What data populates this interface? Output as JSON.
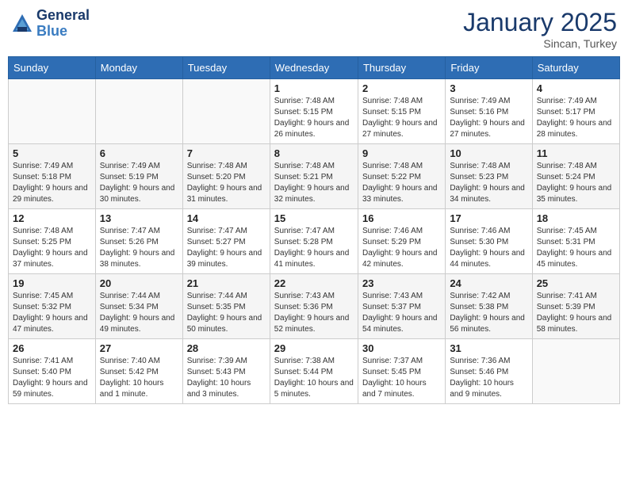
{
  "header": {
    "logo_line1": "General",
    "logo_line2": "Blue",
    "month": "January 2025",
    "location": "Sincan, Turkey"
  },
  "weekdays": [
    "Sunday",
    "Monday",
    "Tuesday",
    "Wednesday",
    "Thursday",
    "Friday",
    "Saturday"
  ],
  "weeks": [
    [
      {
        "day": "",
        "info": ""
      },
      {
        "day": "",
        "info": ""
      },
      {
        "day": "",
        "info": ""
      },
      {
        "day": "1",
        "info": "Sunrise: 7:48 AM\nSunset: 5:15 PM\nDaylight: 9 hours and 26 minutes."
      },
      {
        "day": "2",
        "info": "Sunrise: 7:48 AM\nSunset: 5:15 PM\nDaylight: 9 hours and 27 minutes."
      },
      {
        "day": "3",
        "info": "Sunrise: 7:49 AM\nSunset: 5:16 PM\nDaylight: 9 hours and 27 minutes."
      },
      {
        "day": "4",
        "info": "Sunrise: 7:49 AM\nSunset: 5:17 PM\nDaylight: 9 hours and 28 minutes."
      }
    ],
    [
      {
        "day": "5",
        "info": "Sunrise: 7:49 AM\nSunset: 5:18 PM\nDaylight: 9 hours and 29 minutes."
      },
      {
        "day": "6",
        "info": "Sunrise: 7:49 AM\nSunset: 5:19 PM\nDaylight: 9 hours and 30 minutes."
      },
      {
        "day": "7",
        "info": "Sunrise: 7:48 AM\nSunset: 5:20 PM\nDaylight: 9 hours and 31 minutes."
      },
      {
        "day": "8",
        "info": "Sunrise: 7:48 AM\nSunset: 5:21 PM\nDaylight: 9 hours and 32 minutes."
      },
      {
        "day": "9",
        "info": "Sunrise: 7:48 AM\nSunset: 5:22 PM\nDaylight: 9 hours and 33 minutes."
      },
      {
        "day": "10",
        "info": "Sunrise: 7:48 AM\nSunset: 5:23 PM\nDaylight: 9 hours and 34 minutes."
      },
      {
        "day": "11",
        "info": "Sunrise: 7:48 AM\nSunset: 5:24 PM\nDaylight: 9 hours and 35 minutes."
      }
    ],
    [
      {
        "day": "12",
        "info": "Sunrise: 7:48 AM\nSunset: 5:25 PM\nDaylight: 9 hours and 37 minutes."
      },
      {
        "day": "13",
        "info": "Sunrise: 7:47 AM\nSunset: 5:26 PM\nDaylight: 9 hours and 38 minutes."
      },
      {
        "day": "14",
        "info": "Sunrise: 7:47 AM\nSunset: 5:27 PM\nDaylight: 9 hours and 39 minutes."
      },
      {
        "day": "15",
        "info": "Sunrise: 7:47 AM\nSunset: 5:28 PM\nDaylight: 9 hours and 41 minutes."
      },
      {
        "day": "16",
        "info": "Sunrise: 7:46 AM\nSunset: 5:29 PM\nDaylight: 9 hours and 42 minutes."
      },
      {
        "day": "17",
        "info": "Sunrise: 7:46 AM\nSunset: 5:30 PM\nDaylight: 9 hours and 44 minutes."
      },
      {
        "day": "18",
        "info": "Sunrise: 7:45 AM\nSunset: 5:31 PM\nDaylight: 9 hours and 45 minutes."
      }
    ],
    [
      {
        "day": "19",
        "info": "Sunrise: 7:45 AM\nSunset: 5:32 PM\nDaylight: 9 hours and 47 minutes."
      },
      {
        "day": "20",
        "info": "Sunrise: 7:44 AM\nSunset: 5:34 PM\nDaylight: 9 hours and 49 minutes."
      },
      {
        "day": "21",
        "info": "Sunrise: 7:44 AM\nSunset: 5:35 PM\nDaylight: 9 hours and 50 minutes."
      },
      {
        "day": "22",
        "info": "Sunrise: 7:43 AM\nSunset: 5:36 PM\nDaylight: 9 hours and 52 minutes."
      },
      {
        "day": "23",
        "info": "Sunrise: 7:43 AM\nSunset: 5:37 PM\nDaylight: 9 hours and 54 minutes."
      },
      {
        "day": "24",
        "info": "Sunrise: 7:42 AM\nSunset: 5:38 PM\nDaylight: 9 hours and 56 minutes."
      },
      {
        "day": "25",
        "info": "Sunrise: 7:41 AM\nSunset: 5:39 PM\nDaylight: 9 hours and 58 minutes."
      }
    ],
    [
      {
        "day": "26",
        "info": "Sunrise: 7:41 AM\nSunset: 5:40 PM\nDaylight: 9 hours and 59 minutes."
      },
      {
        "day": "27",
        "info": "Sunrise: 7:40 AM\nSunset: 5:42 PM\nDaylight: 10 hours and 1 minute."
      },
      {
        "day": "28",
        "info": "Sunrise: 7:39 AM\nSunset: 5:43 PM\nDaylight: 10 hours and 3 minutes."
      },
      {
        "day": "29",
        "info": "Sunrise: 7:38 AM\nSunset: 5:44 PM\nDaylight: 10 hours and 5 minutes."
      },
      {
        "day": "30",
        "info": "Sunrise: 7:37 AM\nSunset: 5:45 PM\nDaylight: 10 hours and 7 minutes."
      },
      {
        "day": "31",
        "info": "Sunrise: 7:36 AM\nSunset: 5:46 PM\nDaylight: 10 hours and 9 minutes."
      },
      {
        "day": "",
        "info": ""
      }
    ]
  ]
}
